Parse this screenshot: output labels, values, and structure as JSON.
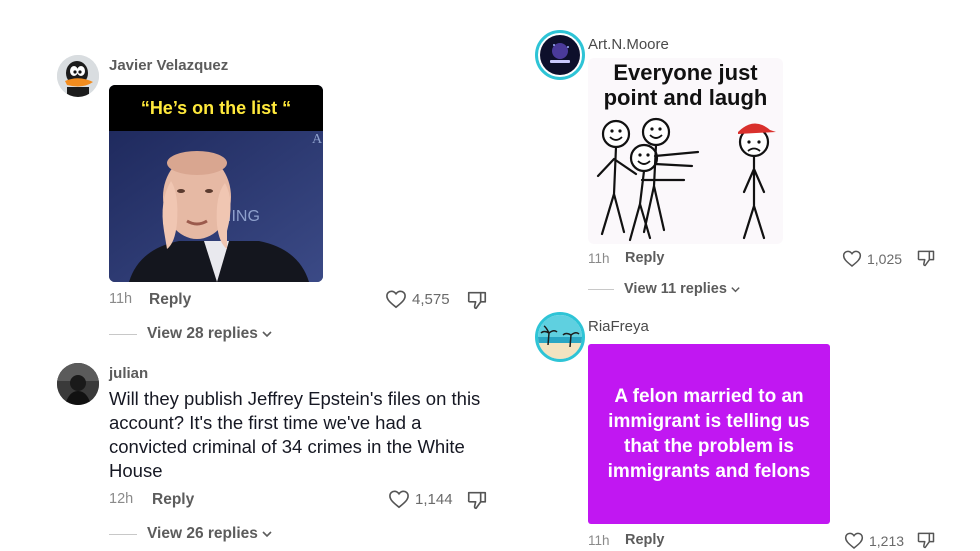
{
  "comments": [
    {
      "username": "Javier Velazquez",
      "image_caption": "“He’s on the list “",
      "time": "11h",
      "reply": "Reply",
      "likes": "4,575",
      "view_replies": "View 28 replies"
    },
    {
      "username": "julian",
      "text": "Will they publish Jeffrey Epstein's files on this account? It's the first time we've had a convicted criminal of 34 crimes in the White House",
      "time": "12h",
      "reply": "Reply",
      "likes": "1,144",
      "view_replies": "View 26 replies"
    },
    {
      "username": "Art.N.Moore",
      "image_caption_line1": "Everyone just",
      "image_caption_line2": "point and laugh",
      "time": "11h",
      "reply": "Reply",
      "likes": "1,025",
      "view_replies": "View 11 replies"
    },
    {
      "username": "RiaFreya",
      "image_caption": "A felon married to an immigrant is telling us that the problem is immigrants and felons",
      "time": "11h",
      "reply": "Reply",
      "likes": "1,213"
    }
  ],
  "colors": {
    "text_primary": "#161823",
    "text_secondary": "#5c5c5c",
    "meme_purple": "#c117f2",
    "caption_yellow": "#ffe93b",
    "avatar_ring": "#2ec4d6"
  },
  "icons": {
    "like": "heart-outline-icon",
    "dislike": "thumbs-down-icon",
    "chevron": "chevron-down-icon"
  }
}
